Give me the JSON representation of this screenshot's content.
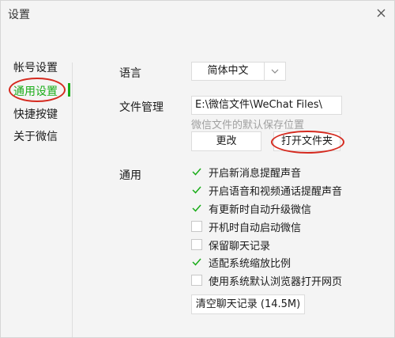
{
  "window": {
    "title": "设置"
  },
  "sidebar": {
    "items": [
      {
        "label": "帐号设置"
      },
      {
        "label": "通用设置"
      },
      {
        "label": "快捷按键"
      },
      {
        "label": "关于微信"
      }
    ],
    "active_index": 1
  },
  "language": {
    "label": "语言",
    "selected": "简体中文"
  },
  "file_management": {
    "label": "文件管理",
    "path": "E:\\微信文件\\WeChat Files\\",
    "hint": "微信文件的默认保存位置",
    "change_button": "更改",
    "open_folder_button": "打开文件夹"
  },
  "general": {
    "label": "通用",
    "options": [
      {
        "label": "开启新消息提醒声音",
        "checked": true
      },
      {
        "label": "开启语音和视频通话提醒声音",
        "checked": true
      },
      {
        "label": "有更新时自动升级微信",
        "checked": true
      },
      {
        "label": "开机时自动启动微信",
        "checked": false
      },
      {
        "label": "保留聊天记录",
        "checked": false
      },
      {
        "label": "适配系统缩放比例",
        "checked": true
      },
      {
        "label": "使用系统默认浏览器打开网页",
        "checked": false
      }
    ],
    "clear_history_button": "清空聊天记录 (14.5M)"
  },
  "colors": {
    "accent": "#1aad19",
    "annotation": "#d52a1f"
  }
}
